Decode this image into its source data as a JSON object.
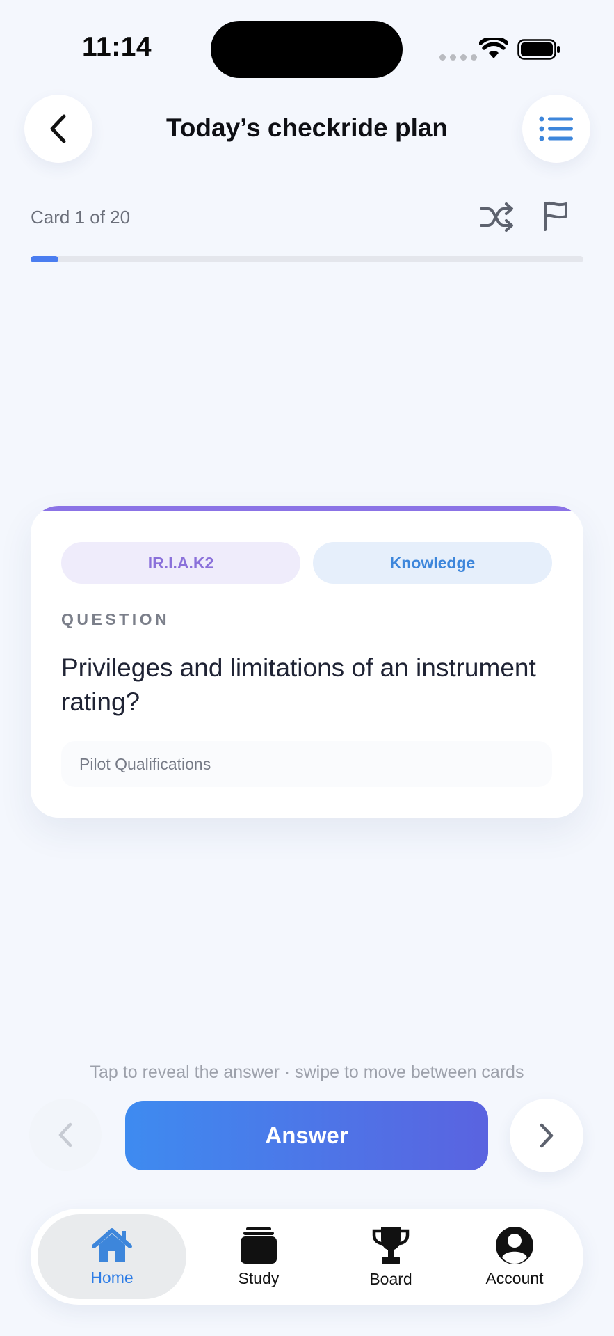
{
  "status_bar": {
    "time": "11:14"
  },
  "header": {
    "title": "Today’s checkride plan"
  },
  "session": {
    "card_count": "Card 1 of 20",
    "progress": 0.05
  },
  "card": {
    "code": "IR.I.A.K2",
    "type": "Knowledge",
    "section_label": "QUESTION",
    "question": "Privileges and limitations of an instrument rating?",
    "topic": "Pilot Qualifications"
  },
  "hint": "Tap to reveal the answer · swipe to move between cards",
  "controls": {
    "answer_label": "Answer"
  },
  "tabs": [
    {
      "label": "Home",
      "icon": "house-icon",
      "active": true
    },
    {
      "label": "Study",
      "icon": "cards-stack-icon",
      "active": false
    },
    {
      "label": "Board",
      "icon": "trophy-icon",
      "active": false
    },
    {
      "label": "Account",
      "icon": "person-circle-icon",
      "active": false
    }
  ],
  "colors": {
    "accent": "#3e8bf0",
    "card_accent": "#8b73e6",
    "background": "#f4f7fd"
  }
}
